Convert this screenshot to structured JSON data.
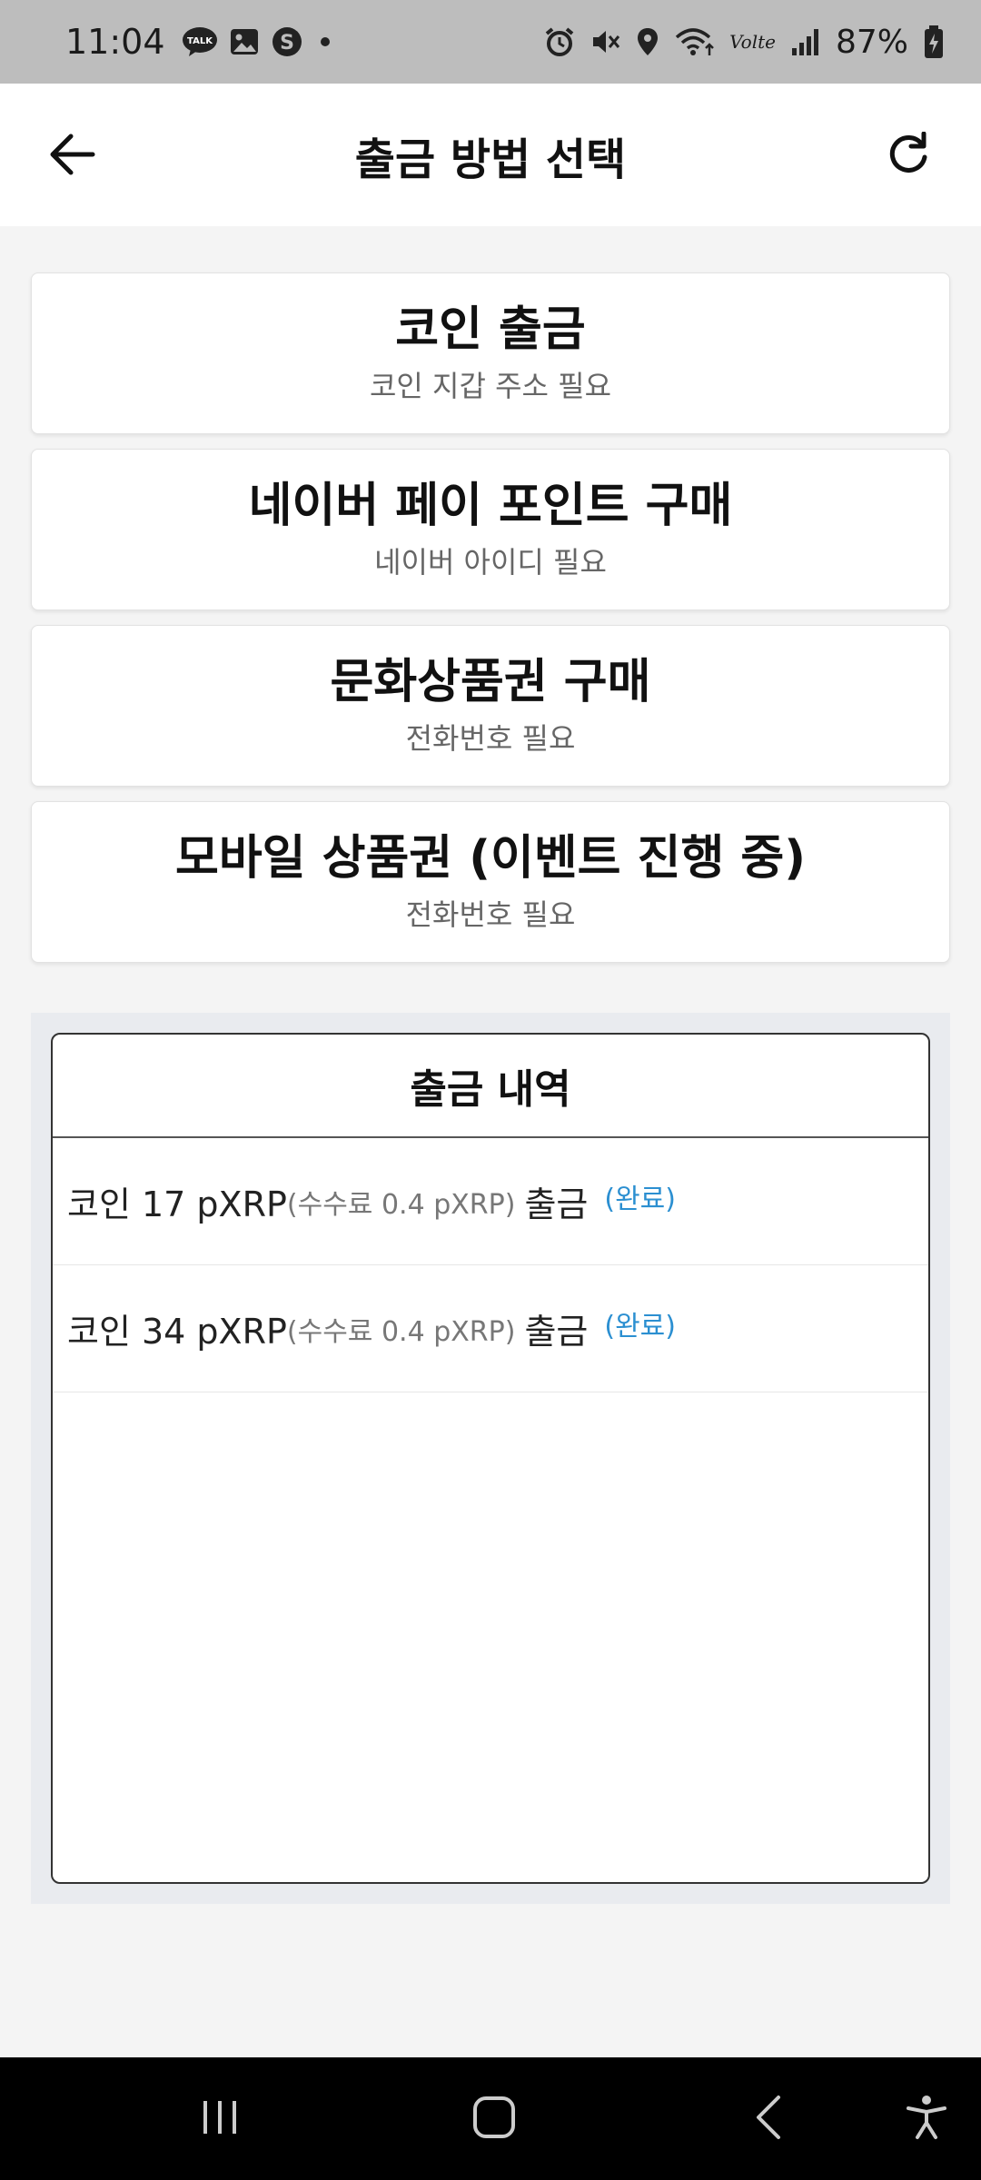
{
  "status_bar": {
    "time": "11:04",
    "battery": "87%",
    "left_icons": [
      "kakaotalk-icon",
      "gallery-icon",
      "app-s-icon",
      "dot-icon"
    ],
    "right_icons": [
      "alarm-icon",
      "mute-icon",
      "location-icon",
      "wifi-icon",
      "volte-icon",
      "signal-icon",
      "battery-icon"
    ],
    "volte_label": "Volte"
  },
  "header": {
    "title": "출금 방법 선택",
    "back_icon": "arrow-left-icon",
    "refresh_icon": "refresh-icon"
  },
  "options": [
    {
      "title": "코인 출금",
      "subtitle": "코인 지갑 주소 필요"
    },
    {
      "title": "네이버 페이 포인트 구매",
      "subtitle": "네이버 아이디 필요"
    },
    {
      "title": "문화상품권 구매",
      "subtitle": "전화번호 필요"
    },
    {
      "title": "모바일 상품권 (이벤트 진행 중)",
      "subtitle": "전화번호 필요"
    }
  ],
  "history": {
    "title": "출금 내역",
    "rows": [
      {
        "amount": "코인 17 pXRP",
        "fee": "(수수료 0.4 pXRP)",
        "action": "출금",
        "status": "(완료)"
      },
      {
        "amount": "코인 34 pXRP",
        "fee": "(수수료 0.4 pXRP)",
        "action": "출금",
        "status": "(완료)"
      }
    ]
  },
  "nav_bar": {
    "icons": [
      "recent-apps-icon",
      "home-icon",
      "back-icon",
      "accessibility-icon"
    ]
  },
  "colors": {
    "status_bar_bg": "#bdbdbd",
    "status_done": "#2b8fd1",
    "nav_bg": "#000000"
  }
}
